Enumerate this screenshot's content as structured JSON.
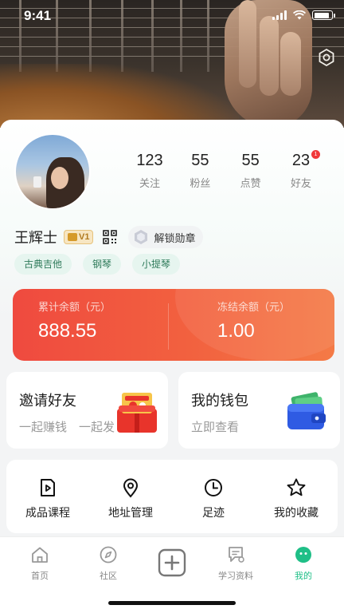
{
  "status_bar": {
    "time": "9:41"
  },
  "profile": {
    "name": "王辉士",
    "vip_level": "V1",
    "medal_button_label": "解锁勋章",
    "stats": [
      {
        "value": "123",
        "label": "关注"
      },
      {
        "value": "55",
        "label": "粉丝"
      },
      {
        "value": "55",
        "label": "点赞"
      },
      {
        "value": "23",
        "label": "好友",
        "badge": "1"
      }
    ],
    "tags": [
      "古典吉他",
      "钢琴",
      "小提琴"
    ]
  },
  "balance": {
    "total_label": "累计余额（元）",
    "total_value": "888.55",
    "frozen_label": "冻结余额（元）",
    "frozen_value": "1.00"
  },
  "promos": {
    "invite": {
      "title": "邀请好友",
      "subtitle": "一起赚钱　一起发"
    },
    "wallet": {
      "title": "我的钱包",
      "subtitle": "立即查看"
    }
  },
  "menu": [
    {
      "label": "成品课程",
      "icon": "video-file-icon"
    },
    {
      "label": "地址管理",
      "icon": "location-pin-icon"
    },
    {
      "label": "足迹",
      "icon": "clock-icon"
    },
    {
      "label": "我的收藏",
      "icon": "star-icon"
    }
  ],
  "tabbar": [
    {
      "label": "首页",
      "icon": "home-icon"
    },
    {
      "label": "社区",
      "icon": "compass-icon"
    },
    {
      "label": "",
      "icon": "add-icon"
    },
    {
      "label": "学习资料",
      "icon": "learning-materials-icon"
    },
    {
      "label": "我的",
      "icon": "profile-icon",
      "active": true
    }
  ],
  "colors": {
    "accent_green": "#1fbf87",
    "balance_red": "#ef4a3f",
    "tag_bg": "#e6f5ef",
    "tag_text": "#2e7a5a"
  }
}
